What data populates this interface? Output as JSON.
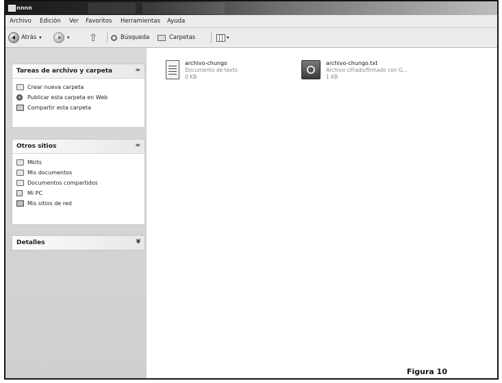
{
  "window": {
    "title": "nnnn"
  },
  "menu": [
    "Archivo",
    "Edición",
    "Ver",
    "Favoritos",
    "Herramientas",
    "Ayuda"
  ],
  "toolbar": {
    "back_label": "Atrás",
    "search_label": "Búsqueda",
    "folders_label": "Carpetas"
  },
  "panels": {
    "tasks": {
      "title": "Tareas de archivo y carpeta",
      "items": [
        "Crear nueva carpeta",
        "Publicar esta carpeta en Web",
        "Compartir esta carpeta"
      ]
    },
    "other_places": {
      "title": "Otros sitios",
      "items": [
        "Mkits",
        "Mis documentos",
        "Documentos compartidos",
        "Mi PC",
        "Mis sitios de red"
      ]
    },
    "details": {
      "title": "Detalles"
    }
  },
  "files": [
    {
      "name": "archivo-chungo",
      "type": "Documento de texto",
      "size": "0 KB",
      "icon": "text-file-icon"
    },
    {
      "name": "archivo-chungo.txt",
      "type": "Archivo cifrado/firmado con G...",
      "size": "1 KB",
      "icon": "encrypted-safe-icon"
    }
  ],
  "caption": "Figura 10"
}
